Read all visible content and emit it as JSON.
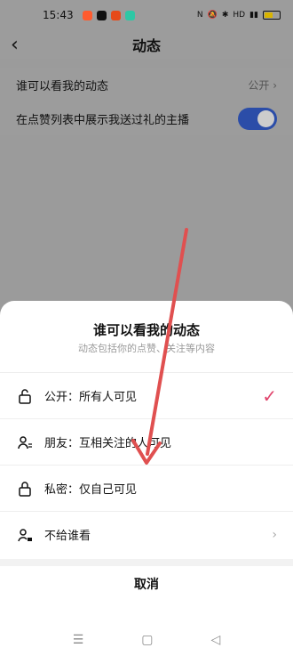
{
  "status": {
    "time": "15:43",
    "right_text": "HD",
    "colors": {
      "app1": "#ff5b2e",
      "app2": "#111111",
      "app3": "#e64a19",
      "app4": "#2ec7a5"
    }
  },
  "header": {
    "title": "动态",
    "back_icon": "chevron-left-icon"
  },
  "settings": {
    "who_can_see_label": "谁可以看我的动态",
    "who_can_see_value": "公开",
    "show_gift_label": "在点赞列表中展示我送过礼的主播"
  },
  "sheet": {
    "title": "谁可以看我的动态",
    "subtitle": "动态包括你的点赞、关注等内容",
    "options": [
      {
        "label": "公开：所有人可见",
        "icon": "unlock-icon",
        "selected": true
      },
      {
        "label": "朋友：互相关注的人可见",
        "icon": "friends-icon",
        "selected": false
      },
      {
        "label": "私密：仅自己可见",
        "icon": "lock-icon",
        "selected": false
      },
      {
        "label": "不给谁看",
        "icon": "user-lock-icon",
        "selected": false
      }
    ],
    "cancel": "取消"
  },
  "navbar": {
    "menu": "☰",
    "home": "▢",
    "back": "◁"
  },
  "accent": {
    "check": "#e0436b",
    "toggle": "#2b4da8",
    "arrow": "#e05050"
  }
}
